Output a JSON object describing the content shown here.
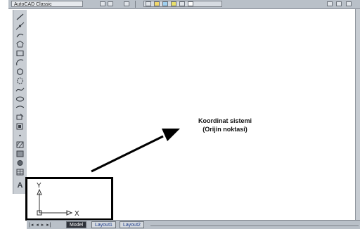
{
  "toolbar": {
    "workspace_label": "AutoCAD Classic"
  },
  "left_tools": {
    "icons": [
      "line-icon",
      "construction-line-icon",
      "polyline-icon",
      "polygon-icon",
      "rectangle-icon",
      "arc-icon",
      "circle-icon",
      "revision-cloud-icon",
      "spline-icon",
      "ellipse-icon",
      "ellipse-arc-icon",
      "insert-block-icon",
      "make-block-icon",
      "point-icon",
      "hatch-icon",
      "gradient-icon",
      "region-icon",
      "table-icon",
      "multiline-text-icon"
    ],
    "text_tool_label": "A"
  },
  "annotation": {
    "line1": "Koordinat sistemi",
    "line2": "(Orijin noktasi)"
  },
  "ucs_icon": {
    "y_label": "Y",
    "x_label": "X"
  },
  "tabs": {
    "nav_arrows": "|◂ ◂ ▸ ▸|",
    "items": [
      {
        "label": "Model",
        "active": true
      },
      {
        "label": "Layout1",
        "active": false
      },
      {
        "label": "Layout2",
        "active": false
      }
    ]
  },
  "colors": {
    "canvas": "#ffffff",
    "chrome": "#b9c0c8",
    "highlight_border": "#000000"
  }
}
